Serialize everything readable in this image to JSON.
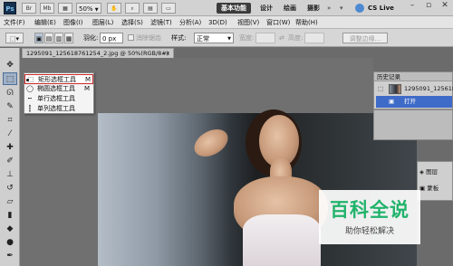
{
  "appbar": {
    "logo": "Ps",
    "zoom": "50%",
    "workspaces": [
      "基本功能",
      "设计",
      "绘画",
      "摄影"
    ],
    "cs_live": "CS Live",
    "icons": [
      "bridge-icon",
      "minibridge-icon",
      "view-extras-icon",
      "zoom-dropdown",
      "hand-icon",
      "zoom-icon",
      "arrange-icon",
      "screen-mode-icon"
    ]
  },
  "menu": {
    "items": [
      "文件(F)",
      "编辑(E)",
      "图像(I)",
      "图层(L)",
      "选择(S)",
      "滤镜(T)",
      "分析(A)",
      "3D(D)",
      "视图(V)",
      "窗口(W)",
      "帮助(H)"
    ]
  },
  "options": {
    "feather_label": "羽化:",
    "feather_value": "0 px",
    "antialias_label": "消除锯齿",
    "style_label": "样式:",
    "style_value": "正常",
    "width_label": "宽度:",
    "height_label": "高度:",
    "refine_edge": "调整边缘..."
  },
  "document": {
    "tab_title": "1295091_125618761254_2.jpg @ 50%(RGB/8#)",
    "close": "×"
  },
  "flyout": {
    "items": [
      {
        "label": "矩形选框工具",
        "key": "M",
        "selected": true
      },
      {
        "label": "椭圆选框工具",
        "key": "M",
        "selected": false
      },
      {
        "label": "单行选框工具",
        "key": "",
        "selected": false
      },
      {
        "label": "单列选框工具",
        "key": "",
        "selected": false
      }
    ]
  },
  "history": {
    "title": "历史记录",
    "snapshot": "1295091_125618",
    "step": "打开"
  },
  "panel2": {
    "items": [
      "图层",
      "蒙板"
    ]
  },
  "watermark": {
    "title": "百科全说",
    "subtitle": "助你轻松解决"
  },
  "colors": {
    "selection_highlight": "#cc2a2a",
    "history_selected": "#3f6bc8",
    "watermark_green": "#20b36b"
  }
}
